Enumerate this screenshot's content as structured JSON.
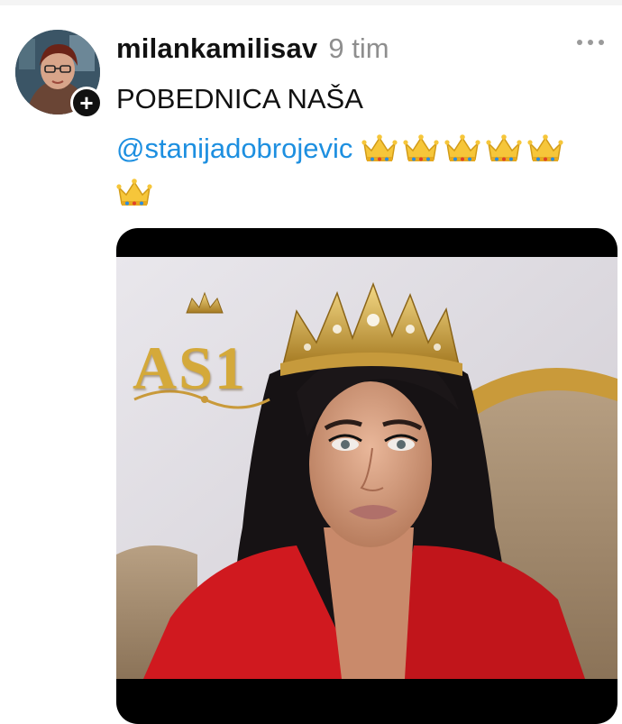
{
  "post": {
    "username": "milankamilisav",
    "time": "9 tim",
    "text": "POBEDNICA NAŠA",
    "mention": "@stanijadobrojevic",
    "crown_emoji_count": 6
  },
  "avatar": {
    "follow_symbol": "+"
  },
  "image": {
    "logo_text": "AS1"
  },
  "icons": {
    "menu": "more-horizontal-icon",
    "crown": "crown-emoji-icon",
    "follow": "plus-icon"
  },
  "colors": {
    "mention": "#1d8fe0",
    "time": "#8e8e8e",
    "username": "#111111",
    "gold": "#d4a93a",
    "jacket_red": "#d0191f"
  }
}
